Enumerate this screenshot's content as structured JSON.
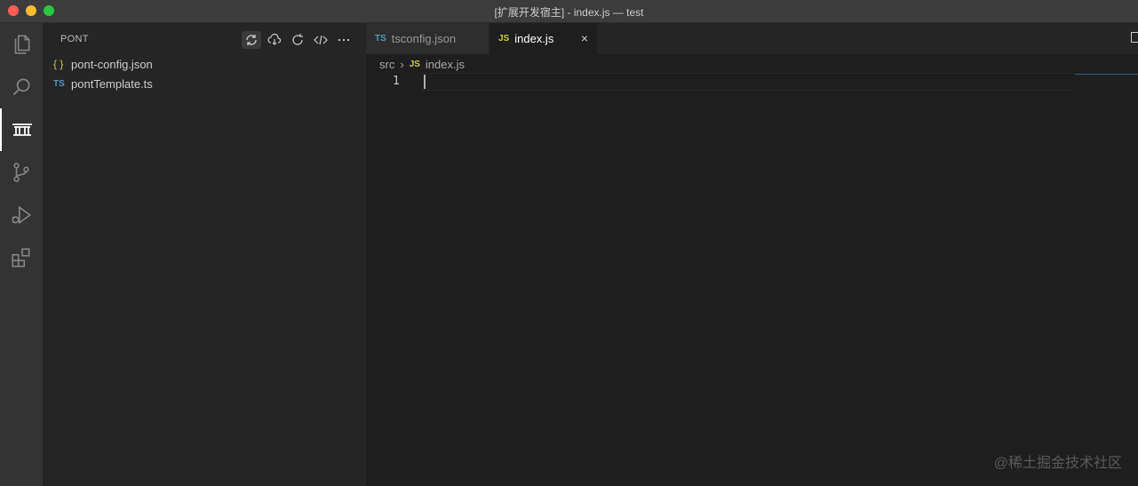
{
  "window": {
    "title": "[扩展开发宿主] - index.js — test"
  },
  "activity_bar": {
    "items": [
      {
        "icon": "files-icon"
      },
      {
        "icon": "search-icon"
      },
      {
        "icon": "pont-icon",
        "active": true
      },
      {
        "icon": "source-control-icon"
      },
      {
        "icon": "run-debug-icon"
      },
      {
        "icon": "extensions-icon"
      }
    ]
  },
  "sidebar": {
    "title": "PONT",
    "actions": [
      "sync-icon",
      "cloud-download-icon",
      "refresh-icon",
      "code-icon",
      "more-icon"
    ],
    "files": [
      {
        "icon_text": "{ }",
        "name": "pont-config.json"
      },
      {
        "icon_text": "TS",
        "name": "pontTemplate.ts"
      }
    ]
  },
  "editor": {
    "tabs": [
      {
        "icon_text": "TS",
        "label": "tsconfig.json",
        "active": false
      },
      {
        "icon_text": "JS",
        "label": "index.js",
        "active": true,
        "close": "×"
      }
    ],
    "breadcrumb": {
      "folder": "src",
      "separator": "›",
      "icon_text": "JS",
      "file": "index.js"
    },
    "line_numbers": [
      "1"
    ]
  },
  "watermark": "@稀土掘金技术社区",
  "colors": {
    "accent": "#007acc",
    "js": "#cbcb41",
    "ts": "#519aba"
  }
}
